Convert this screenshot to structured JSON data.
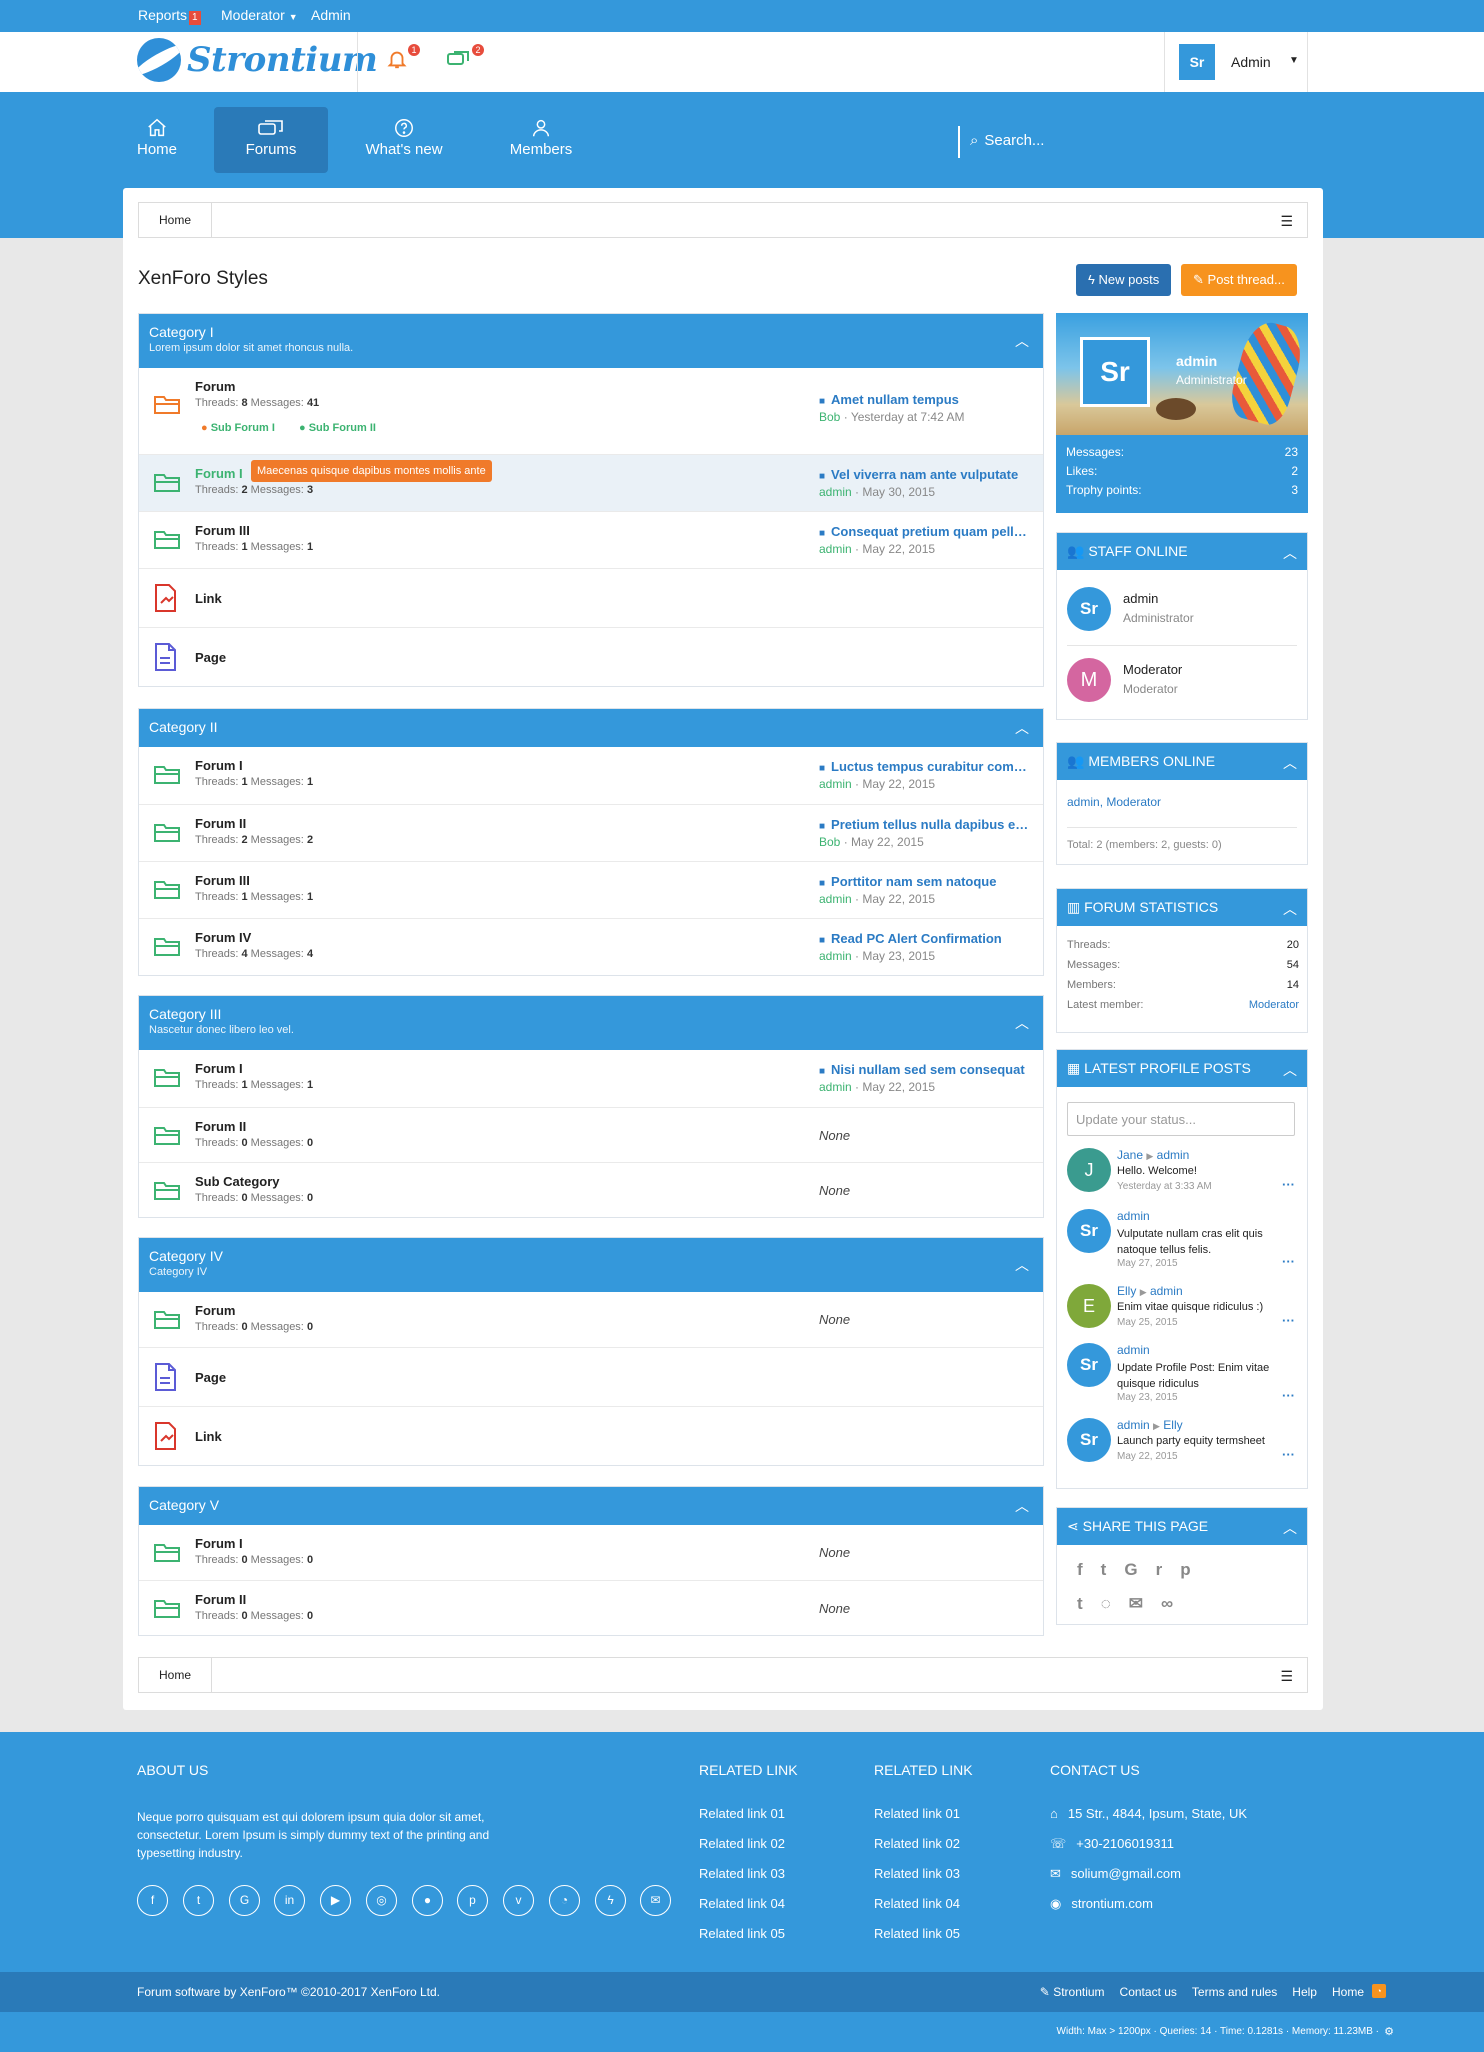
{
  "topbar": {
    "reports": "Reports",
    "reports_count": "1",
    "moderator": "Moderator",
    "admin": "Admin"
  },
  "header": {
    "logo_text": "Strontium",
    "alerts_count": "1",
    "conversations_count": "2",
    "account_initials": "Sr",
    "account_name": "Admin"
  },
  "nav": {
    "tabs": [
      {
        "label": "Home",
        "icon": "home-icon"
      },
      {
        "label": "Forums",
        "icon": "forums-icon"
      },
      {
        "label": "What's new",
        "icon": "question-icon"
      },
      {
        "label": "Members",
        "icon": "user-icon"
      }
    ],
    "search_placeholder": "Search..."
  },
  "breadcrumb": {
    "home": "Home"
  },
  "page": {
    "title": "XenForo Styles",
    "new_posts": "New posts",
    "post_thread": "Post thread..."
  },
  "stats_labels": {
    "threads": "Threads:",
    "messages": "Messages:"
  },
  "categories": [
    {
      "title": "Category I",
      "desc": "Lorem ipsum dolor sit amet rhoncus nulla.",
      "rows": [
        {
          "name": "Forum",
          "threads": "8",
          "messages": "41",
          "last_title": "Amet nullam tempus",
          "last_user": "Bob",
          "last_date": "Yesterday at 7:42 AM",
          "subforums": [
            "Sub Forum I",
            "Sub Forum II"
          ]
        },
        {
          "name": "Forum I",
          "threads": "2",
          "messages": "3",
          "last_title": "Vel viverra nam ante vulputate",
          "last_user": "admin",
          "last_date": "May 30, 2015",
          "tooltip": "Maecenas quisque dapibus montes mollis ante"
        },
        {
          "name": "Forum III",
          "threads": "1",
          "messages": "1",
          "last_title": "Consequat pretium quam pellentesque",
          "last_user": "admin",
          "last_date": "May 22, 2015"
        },
        {
          "name": "Link"
        },
        {
          "name": "Page"
        }
      ]
    },
    {
      "title": "Category II",
      "desc": "",
      "rows": [
        {
          "name": "Forum I",
          "threads": "1",
          "messages": "1",
          "last_title": "Luctus tempus curabitur commodo",
          "last_user": "admin",
          "last_date": "May 22, 2015"
        },
        {
          "name": "Forum II",
          "threads": "2",
          "messages": "2",
          "last_title": "Pretium tellus nulla dapibus enim",
          "last_user": "Bob",
          "last_date": "May 22, 2015"
        },
        {
          "name": "Forum III",
          "threads": "1",
          "messages": "1",
          "last_title": "Porttitor nam sem natoque",
          "last_user": "admin",
          "last_date": "May 22, 2015"
        },
        {
          "name": "Forum IV",
          "threads": "4",
          "messages": "4",
          "last_title": "Read PC Alert Confirmation",
          "last_user": "admin",
          "last_date": "May 23, 2015"
        }
      ]
    },
    {
      "title": "Category III",
      "desc": "Nascetur donec libero leo vel.",
      "rows": [
        {
          "name": "Forum I",
          "threads": "1",
          "messages": "1",
          "last_title": "Nisi nullam sed sem consequat",
          "last_user": "admin",
          "last_date": "May 22, 2015"
        },
        {
          "name": "Forum II",
          "threads": "0",
          "messages": "0",
          "none": "None"
        },
        {
          "name": "Sub Category",
          "threads": "0",
          "messages": "0",
          "none": "None"
        }
      ]
    },
    {
      "title": "Category IV",
      "desc": "Category IV",
      "rows": [
        {
          "name": "Forum",
          "threads": "0",
          "messages": "0",
          "none": "None"
        },
        {
          "name": "Page"
        },
        {
          "name": "Link"
        }
      ]
    },
    {
      "title": "Category V",
      "desc": "",
      "rows": [
        {
          "name": "Forum I",
          "threads": "0",
          "messages": "0",
          "none": "None"
        },
        {
          "name": "Forum II",
          "threads": "0",
          "messages": "0",
          "none": "None"
        }
      ]
    }
  ],
  "profile_card": {
    "initials": "Sr",
    "name": "admin",
    "role": "Administrator",
    "stats": [
      {
        "label": "Messages:",
        "value": "23"
      },
      {
        "label": "Likes:",
        "value": "2"
      },
      {
        "label": "Trophy points:",
        "value": "3"
      }
    ]
  },
  "staff_online": {
    "title": "Staff online",
    "members": [
      {
        "initials": "Sr",
        "name": "admin",
        "role": "Administrator",
        "color": "#3498db"
      },
      {
        "initials": "M",
        "name": "Moderator",
        "role": "Moderator",
        "color": "#d466a0"
      }
    ]
  },
  "members_online": {
    "title": "Members online",
    "user1": "admin",
    "user2": "Moderator",
    "total": "Total: 2 (members: 2, guests: 0)"
  },
  "forum_stats": {
    "title": "Forum statistics",
    "rows": [
      {
        "label": "Threads:",
        "value": "20"
      },
      {
        "label": "Messages:",
        "value": "54"
      },
      {
        "label": "Members:",
        "value": "14"
      },
      {
        "label": "Latest member:",
        "value": "Moderator"
      }
    ]
  },
  "profile_posts": {
    "title": "Latest profile posts",
    "placeholder": "Update your status...",
    "posts": [
      {
        "initials": "J",
        "color": "#3a9b8f",
        "from": "Jane",
        "to": "admin",
        "text": "Hello. Welcome!",
        "date": "Yesterday at 3:33 AM"
      },
      {
        "initials": "Sr",
        "color": "#3498db",
        "from": "admin",
        "to": "",
        "text": "Vulputate nullam cras elit quis natoque tellus felis.",
        "date": "May 27, 2015"
      },
      {
        "initials": "E",
        "color": "#7fa83a",
        "from": "Elly",
        "to": "admin",
        "text": "Enim vitae quisque ridiculus :)",
        "date": "May 25, 2015"
      },
      {
        "initials": "Sr",
        "color": "#3498db",
        "from": "admin",
        "to": "",
        "text": "Update Profile Post: Enim vitae quisque ridiculus",
        "date": "May 23, 2015"
      },
      {
        "initials": "Sr",
        "color": "#3498db",
        "from": "admin",
        "to": "Elly",
        "text": "Launch party equity termsheet",
        "date": "May 22, 2015"
      }
    ]
  },
  "share": {
    "title": "Share this page"
  },
  "footer": {
    "about_title": "About us",
    "about_text": "Neque porro quisquam est qui dolorem ipsum quia dolor sit amet, consectetur. Lorem Ipsum is simply dummy text of the printing and typesetting industry.",
    "related_title": "Related link",
    "links": [
      "Related link 01",
      "Related link 02",
      "Related link 03",
      "Related link 04",
      "Related link 05"
    ],
    "contact_title": "Contact us",
    "contact": [
      "15 Str., 4844, Ipsum, State, UK",
      "+30-2106019311",
      "solium@gmail.com",
      "strontium.com"
    ],
    "copyright": "Forum software by XenForo™ ©2010-2017 XenForo Ltd.",
    "bottom_links": [
      "Strontium",
      "Contact us",
      "Terms and rules",
      "Help",
      "Home"
    ],
    "debug": "Width: Max > 1200px · Queries: 14 · Time: 0.1281s · Memory: 11.23MB ·"
  },
  "colors": {
    "primary": "#3498db",
    "dark": "#2a7ab8",
    "orange": "#f7931e",
    "green": "#3cb371",
    "link": "#2b7bc4"
  }
}
